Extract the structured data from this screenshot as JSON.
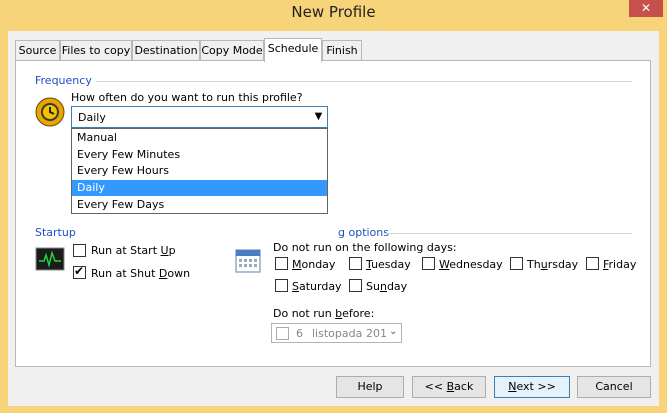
{
  "window": {
    "title": "New Profile",
    "close_glyph": "✕"
  },
  "tabs": [
    "Source",
    "Files to copy",
    "Destination",
    "Copy Mode",
    "Schedule",
    "Finish"
  ],
  "active_tab": "Schedule",
  "frequency": {
    "section_label": "Frequency",
    "question": "How often do you want to run this profile?",
    "selected_value": "Daily",
    "options": [
      "Manual",
      "Every Few Minutes",
      "Every Few Hours",
      "Daily",
      "Every Few Days"
    ],
    "icon": "clock-icon"
  },
  "startup": {
    "section_label": "Startup",
    "icon": "monitor-icon",
    "run_at_startup": {
      "label_pre": "Run at Start ",
      "label_u": "U",
      "label_post": "p",
      "checked": false
    },
    "run_at_shutdown": {
      "label_pre": "Run at Shut ",
      "label_u": "D",
      "label_post": "own",
      "checked": true
    }
  },
  "exclusion": {
    "section_label": "g options",
    "icon": "calendar-icon",
    "days_label": "Do not run on the following days:",
    "days": [
      {
        "pre": "",
        "u": "M",
        "post": "onday",
        "checked": false
      },
      {
        "pre": "",
        "u": "T",
        "post": "uesday",
        "checked": false
      },
      {
        "pre": "",
        "u": "W",
        "post": "ednesday",
        "checked": false
      },
      {
        "pre": "Th",
        "u": "u",
        "post": "rsday",
        "checked": false
      },
      {
        "pre": "",
        "u": "F",
        "post": "riday",
        "checked": false
      },
      {
        "pre": "",
        "u": "S",
        "post": "aturday",
        "checked": false
      },
      {
        "pre": "Su",
        "u": "n",
        "post": "day",
        "checked": false
      }
    ],
    "before_label": {
      "pre": "Do not run ",
      "u": "b",
      "post": "efore:"
    },
    "date": {
      "day": "6",
      "month": "listopada",
      "year": "201"
    }
  },
  "buttons": {
    "help": "Help",
    "back": {
      "pre": "<< ",
      "u": "B",
      "post": "ack"
    },
    "next": {
      "pre": "",
      "u": "N",
      "post": "ext >>"
    },
    "cancel": "Cancel"
  },
  "colors": {
    "accent": "#1f4fbf",
    "selection": "#3399ff",
    "frame": "#f7d47a",
    "close": "#c7504a"
  }
}
